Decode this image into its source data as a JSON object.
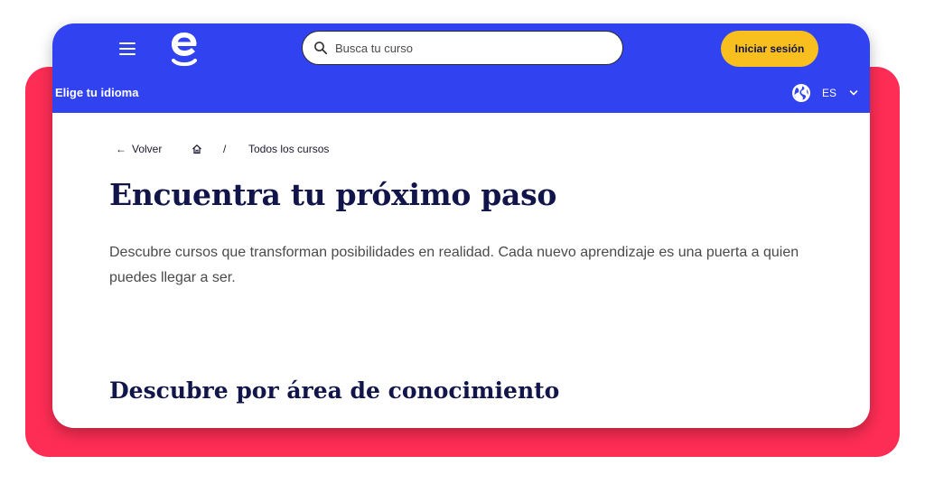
{
  "header": {
    "logo_letter": "e",
    "search": {
      "placeholder": "Busca tu curso",
      "value": ""
    },
    "login_label": "Iniciar sesión"
  },
  "language_bar": {
    "title": "Elige tu idioma",
    "selected_language": "ES"
  },
  "breadcrumb": {
    "back_label": "Volver",
    "separator": "/",
    "current": "Todos los cursos"
  },
  "main": {
    "title": "Encuentra tu próximo paso",
    "intro": "Descubre cursos que transforman posibilidades en realidad. Cada nuevo aprendizaje es una puerta a quien puedes llegar a ser.",
    "section_title": "Descubre por área de conocimiento"
  },
  "colors": {
    "brand_blue": "#3142f1",
    "accent_yellow": "#f9bf1e",
    "backdrop_red": "#fe2d55",
    "heading_navy": "#12154a"
  },
  "icons": {
    "menu": "hamburger-menu-icon",
    "logo": "brand-logo",
    "search": "magnifier-icon",
    "language": "globe-icon",
    "dropdown": "chevron-down-icon",
    "back": "arrow-left-icon",
    "home": "home-icon"
  }
}
